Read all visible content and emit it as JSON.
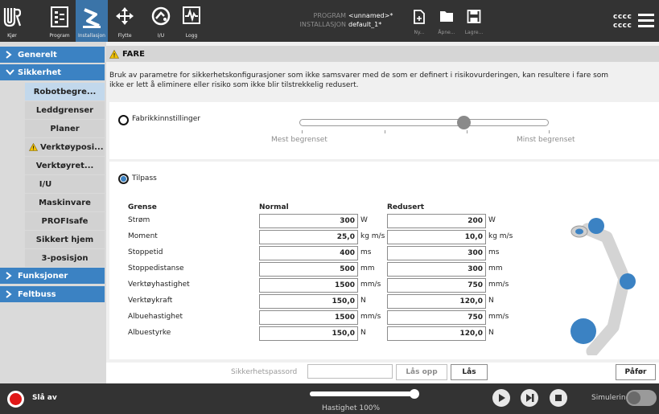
{
  "topbar": {
    "buttons": [
      {
        "label": "Kjør",
        "icon": "ur-logo-icon"
      },
      {
        "label": "Program",
        "icon": "program-icon"
      },
      {
        "label": "Installasjon",
        "icon": "installation-icon"
      },
      {
        "label": "Flytte",
        "icon": "move-icon"
      },
      {
        "label": "I/U",
        "icon": "io-icon"
      },
      {
        "label": "Logg",
        "icon": "log-icon"
      }
    ],
    "program_key": "PROGRAM",
    "program_value": "<unnamed>*",
    "installation_key": "INSTALLASJON",
    "installation_value": "default_1*",
    "file_buttons": [
      {
        "label": "Ny...",
        "icon": "new-file-icon"
      },
      {
        "label": "Åpne...",
        "icon": "open-folder-icon"
      },
      {
        "label": "Lagre...",
        "icon": "save-icon"
      }
    ],
    "user_line1": "cccc",
    "user_line2": "cccc"
  },
  "sidebar": {
    "sections": [
      "Generelt",
      "Sikkerhet",
      "Funksjoner",
      "Feltbuss"
    ],
    "items": [
      "Robotbegre...",
      "Leddgrenser",
      "Planer",
      "Verktøyposi...",
      "Verktøyret...",
      "I/U",
      "Maskinvare",
      "PROFIsafe",
      "Sikkert hjem",
      "3-posisjon"
    ]
  },
  "main": {
    "fare_title": "FARE",
    "warning_text_1": "Bruk av parametre for sikkerhetskonfigurasjoner som ikke samsvarer med de som er definert i risikovurderingen, kan resultere i fare som",
    "warning_text_2": "ikke er lett å eliminere eller risiko som ikke blir tilstrekkelig redusert.",
    "factory_label": "Fabrikkinnstillinger",
    "most_restricted": "Mest begrenset",
    "least_restricted": "Minst begrenset",
    "custom_label": "Tilpass",
    "limits": {
      "col_limit": "Grense",
      "col_normal": "Normal",
      "col_reduced": "Redusert",
      "rows": [
        {
          "label": "Strøm",
          "normal": "300",
          "normal_unit": "W",
          "reduced": "200",
          "reduced_unit": "W"
        },
        {
          "label": "Moment",
          "normal": "25,0",
          "normal_unit": "kg m/s",
          "reduced": "10,0",
          "reduced_unit": "kg m/s"
        },
        {
          "label": "Stoppetid",
          "normal": "400",
          "normal_unit": "ms",
          "reduced": "300",
          "reduced_unit": "ms"
        },
        {
          "label": "Stoppedistanse",
          "normal": "500",
          "normal_unit": "mm",
          "reduced": "300",
          "reduced_unit": "mm"
        },
        {
          "label": "Verktøyhastighet",
          "normal": "1500",
          "normal_unit": "mm/s",
          "reduced": "750",
          "reduced_unit": "mm/s"
        },
        {
          "label": "Verktøykraft",
          "normal": "150,0",
          "normal_unit": "N",
          "reduced": "120,0",
          "reduced_unit": "N"
        },
        {
          "label": "Albuehastighet",
          "normal": "1500",
          "normal_unit": "mm/s",
          "reduced": "750",
          "reduced_unit": "mm/s"
        },
        {
          "label": "Albuestyrke",
          "normal": "150,0",
          "normal_unit": "N",
          "reduced": "120,0",
          "reduced_unit": "N"
        }
      ]
    },
    "password_label": "Sikkerhetspassord",
    "unlock_label": "Lås opp",
    "lock_label": "Lås",
    "apply_label": "Påfør"
  },
  "footer": {
    "power_label": "Slå av",
    "speed_label": "Hastighet 100%",
    "speed_fraction": 1.0,
    "simulation_label": "Simulering",
    "simulation_on": false
  },
  "colors": {
    "accent": "#3b82c3",
    "topbar": "#333333",
    "active_tab": "#3b74a8",
    "power": "#e01818"
  }
}
